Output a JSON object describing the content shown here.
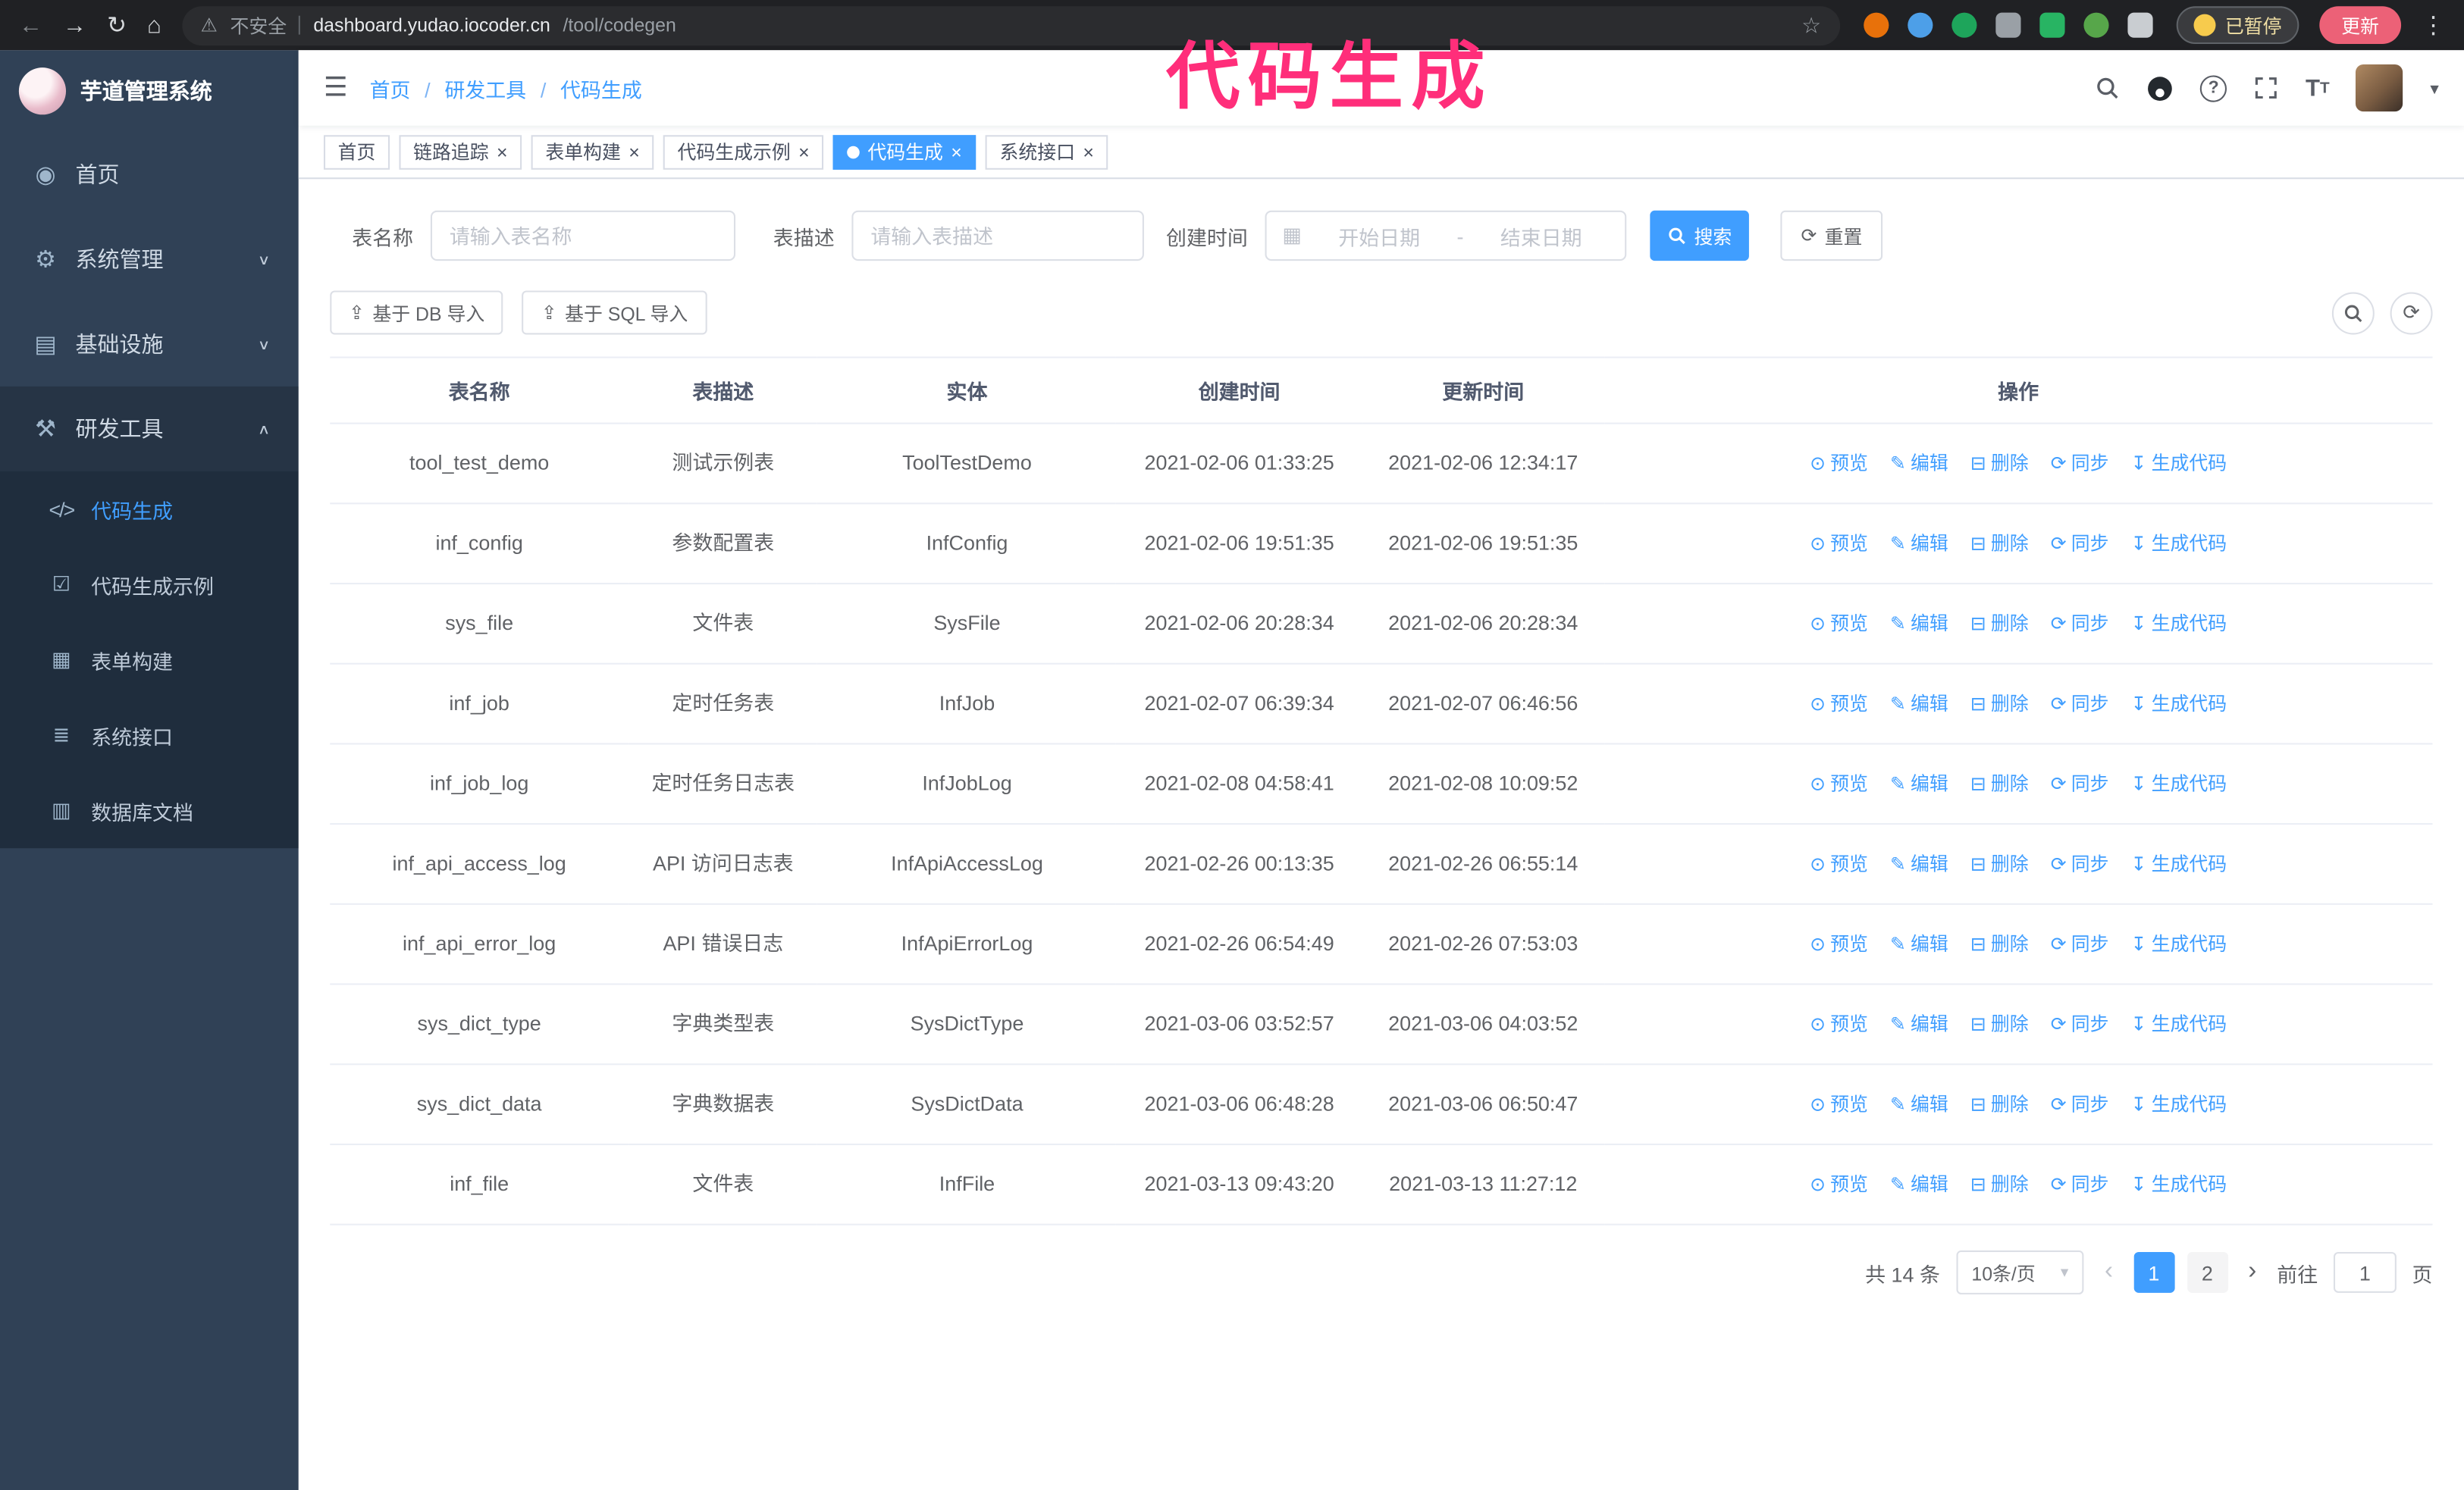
{
  "browser": {
    "security_label": "不安全",
    "url_host": "dashboard.yudao.iocoder.cn",
    "url_path": "/tool/codegen",
    "paused_badge": "已暂停",
    "update_button": "更新"
  },
  "annotation": {
    "text": "代码生成",
    "color": "#ff2e7a"
  },
  "sidebar": {
    "logo_title": "芋道管理系统",
    "items": [
      {
        "label": "首页",
        "name": "sidebar-item-home",
        "icon": "dashboard-icon",
        "glyph": "◉"
      },
      {
        "label": "系统管理",
        "name": "sidebar-item-system",
        "icon": "gear-icon",
        "glyph": "⚙",
        "chevron_glyph": "∨",
        "chevron_name": "chevron-down-icon"
      },
      {
        "label": "基础设施",
        "name": "sidebar-item-infrastructure",
        "icon": "monitor-icon",
        "glyph": "▤",
        "chevron_glyph": "∨",
        "chevron_name": "chevron-down-icon"
      },
      {
        "label": "研发工具",
        "name": "sidebar-item-devtools",
        "icon": "tools-icon",
        "glyph": "⚒",
        "chevron_glyph": "∧",
        "chevron_name": "chevron-up-icon",
        "open": true
      }
    ],
    "sub_items": [
      {
        "label": "代码生成",
        "name": "sidebar-item-codegen",
        "icon": "code-icon",
        "glyph": "</>",
        "active": true
      },
      {
        "label": "代码生成示例",
        "name": "sidebar-item-codegen-example",
        "icon": "shield-check-icon",
        "glyph": "☑"
      },
      {
        "label": "表单构建",
        "name": "sidebar-item-form-builder",
        "icon": "form-icon",
        "glyph": "▦"
      },
      {
        "label": "系统接口",
        "name": "sidebar-item-system-api",
        "icon": "sliders-icon",
        "glyph": "≣"
      },
      {
        "label": "数据库文档",
        "name": "sidebar-item-db-doc",
        "icon": "database-doc-icon",
        "glyph": "▥"
      }
    ]
  },
  "breadcrumb": [
    "首页",
    "研发工具",
    "代码生成"
  ],
  "tabs": [
    {
      "label": "首页"
    },
    {
      "label": "链路追踪",
      "closable": true
    },
    {
      "label": "表单构建",
      "closable": true
    },
    {
      "label": "代码生成示例",
      "closable": true
    },
    {
      "label": "代码生成",
      "closable": true,
      "active": true
    },
    {
      "label": "系统接口",
      "closable": true
    }
  ],
  "filters": {
    "table_name_label": "表名称",
    "table_name_placeholder": "请输入表名称",
    "table_desc_label": "表描述",
    "table_desc_placeholder": "请输入表描述",
    "create_time_label": "创建时间",
    "start_date_placeholder": "开始日期",
    "range_separator": "-",
    "end_date_placeholder": "结束日期",
    "search_button": "搜索",
    "reset_button": "重置"
  },
  "toolbar": {
    "import_db": "基于 DB 导入",
    "import_sql": "基于 SQL 导入"
  },
  "table": {
    "columns": [
      "表名称",
      "表描述",
      "实体",
      "创建时间",
      "更新时间",
      "操作"
    ],
    "actions": [
      {
        "label": "预览",
        "name": "preview-link",
        "icon": "eye-icon",
        "glyph": "⊙"
      },
      {
        "label": "编辑",
        "name": "edit-link",
        "icon": "pencil-icon",
        "glyph": "✎"
      },
      {
        "label": "删除",
        "name": "delete-link",
        "icon": "trash-icon",
        "glyph": "⊟"
      },
      {
        "label": "同步",
        "name": "sync-link",
        "icon": "refresh-icon",
        "glyph": "⟳"
      },
      {
        "label": "生成代码",
        "name": "generate-code-link",
        "icon": "download-icon",
        "glyph": "↧"
      }
    ],
    "rows": [
      {
        "name": "tool_test_demo",
        "desc": "测试示例表",
        "entity": "ToolTestDemo",
        "created": "2021-02-06 01:33:25",
        "updated": "2021-02-06 12:34:17"
      },
      {
        "name": "inf_config",
        "desc": "参数配置表",
        "entity": "InfConfig",
        "created": "2021-02-06 19:51:35",
        "updated": "2021-02-06 19:51:35"
      },
      {
        "name": "sys_file",
        "desc": "文件表",
        "entity": "SysFile",
        "created": "2021-02-06 20:28:34",
        "updated": "2021-02-06 20:28:34"
      },
      {
        "name": "inf_job",
        "desc": "定时任务表",
        "entity": "InfJob",
        "created": "2021-02-07 06:39:34",
        "updated": "2021-02-07 06:46:56"
      },
      {
        "name": "inf_job_log",
        "desc": "定时任务日志表",
        "entity": "InfJobLog",
        "created": "2021-02-08 04:58:41",
        "updated": "2021-02-08 10:09:52"
      },
      {
        "name": "inf_api_access_log",
        "desc": "API 访问日志表",
        "entity": "InfApiAccessLog",
        "created": "2021-02-26 00:13:35",
        "updated": "2021-02-26 06:55:14"
      },
      {
        "name": "inf_api_error_log",
        "desc": "API 错误日志",
        "entity": "InfApiErrorLog",
        "created": "2021-02-26 06:54:49",
        "updated": "2021-02-26 07:53:03"
      },
      {
        "name": "sys_dict_type",
        "desc": "字典类型表",
        "entity": "SysDictType",
        "created": "2021-03-06 03:52:57",
        "updated": "2021-03-06 04:03:52"
      },
      {
        "name": "sys_dict_data",
        "desc": "字典数据表",
        "entity": "SysDictData",
        "created": "2021-03-06 06:48:28",
        "updated": "2021-03-06 06:50:47"
      },
      {
        "name": "inf_file",
        "desc": "文件表",
        "entity": "InfFile",
        "created": "2021-03-13 09:43:20",
        "updated": "2021-03-13 11:27:12"
      }
    ]
  },
  "pagination": {
    "total": "共 14 条",
    "page_size": "10条/页",
    "pages": [
      {
        "num": "1",
        "active": true
      },
      {
        "num": "2"
      }
    ],
    "goto_label": "前往",
    "goto_value": "1",
    "page_label": "页"
  }
}
